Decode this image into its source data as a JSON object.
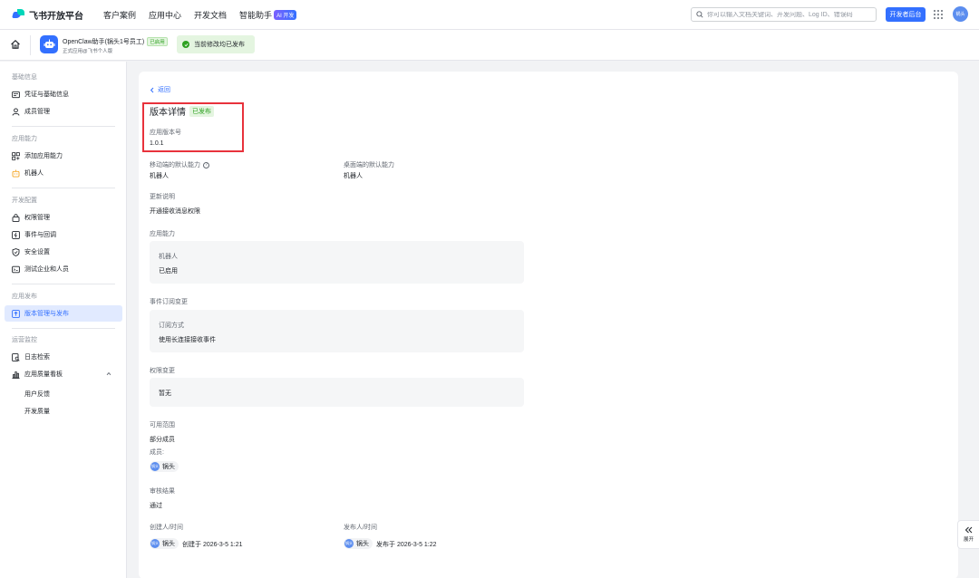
{
  "topnav": {
    "brand": "飞书开放平台",
    "links": [
      "客户案例",
      "应用中心",
      "开发文档",
      "智能助手"
    ],
    "ai_badge": "AI 开发",
    "search_placeholder": "你可以输入文档关键词、开发问题、Log ID、错误码",
    "dev_button": "开发者后台",
    "avatar": "锅头"
  },
  "apphead": {
    "app_name": "OpenClaw助手(锅头1号员工)",
    "app_tag": "已启用",
    "app_sub": "正式应用@飞书个人版",
    "publish_status": "当前修改均已发布"
  },
  "sidebar": {
    "groups": [
      {
        "label": "基础信息",
        "items": [
          "凭证与基础信息",
          "成员管理"
        ]
      },
      {
        "label": "应用能力",
        "items": [
          "添加应用能力",
          "机器人"
        ]
      },
      {
        "label": "开发配置",
        "items": [
          "权限管理",
          "事件与回调",
          "安全设置",
          "测试企业和人员"
        ]
      },
      {
        "label": "应用发布",
        "items": [
          "版本管理与发布"
        ]
      },
      {
        "label": "运营监控",
        "items": [
          "日志检索",
          "应用质量看板"
        ],
        "sub_items": [
          "用户反馈",
          "开发质量"
        ]
      }
    ]
  },
  "main": {
    "back": "返回",
    "title": "版本详情",
    "status": "已发布",
    "version_label": "应用版本号",
    "version_value": "1.0.1",
    "mobile_label": "移动端的默认能力",
    "mobile_value": "机器人",
    "desktop_label": "桌面端的默认能力",
    "desktop_value": "机器人",
    "update_label": "更新说明",
    "update_value": "开通接收消息权限",
    "ability_label": "应用能力",
    "ability_box_title": "机器人",
    "ability_box_value": "已启用",
    "event_label": "事件订阅变更",
    "event_box_title": "订阅方式",
    "event_box_value": "使用长连接接收事件",
    "perm_label": "权限变更",
    "perm_box_value": "暂无",
    "scope_label": "可用范围",
    "scope_value": "部分成员",
    "members_label": "成员:",
    "member_name": "锅头",
    "member_avatar": "锅头",
    "review_label": "审核结果",
    "review_value": "通过",
    "creator_label": "创建人/时间",
    "creator_name": "锅头",
    "creator_time": "创建于 2026-3-5 1:21",
    "publisher_label": "发布人/时间",
    "publisher_name": "锅头",
    "publisher_time": "发布于 2026-3-5 1:22"
  },
  "expand": {
    "label": "展开"
  },
  "colors": {
    "accent": "#3370ff",
    "success": "#2ea121",
    "highlight": "#e8323c"
  }
}
